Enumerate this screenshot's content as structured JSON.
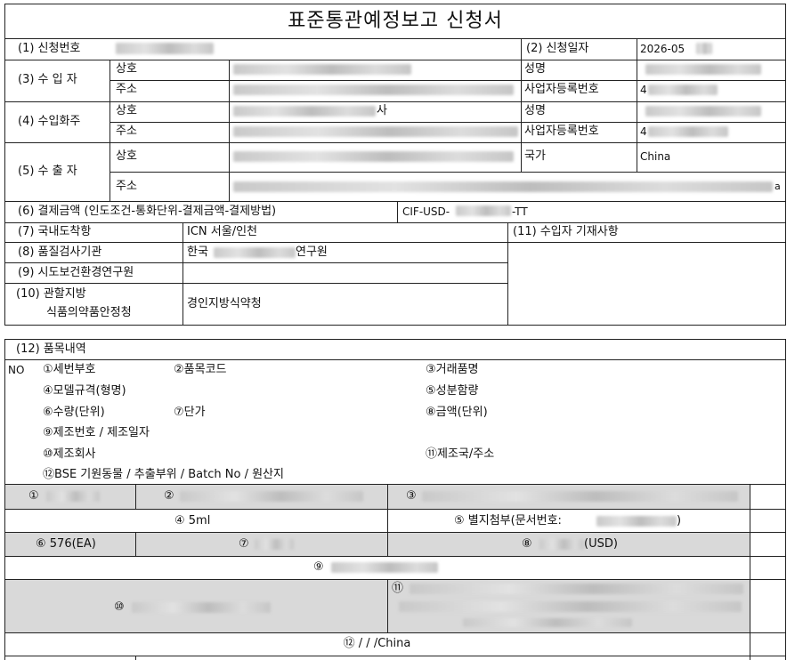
{
  "form": {
    "title": "표준통관예정보고 신청서",
    "row1": {
      "label": "(1) 신청번호",
      "date_label": "(2) 신청일자",
      "date_value": "2026-05"
    },
    "importer": {
      "label": "(3) 수 입 자",
      "trade_name": "상호",
      "address": "주소",
      "rep_name": "성명",
      "biz_reg_no": "사업자등록번호",
      "biz_reg_prefix": "4"
    },
    "owner": {
      "label": "(4) 수입화주",
      "trade_name": "상호",
      "address": "주소",
      "rep_name": "성명",
      "biz_reg_no": "사업자등록번호",
      "biz_reg_prefix": "4",
      "name_suffix": "사"
    },
    "exporter": {
      "label": "(5) 수 출 자",
      "trade_name": "상호",
      "address": "주소",
      "country_label": "국가",
      "country_value": "China",
      "addr_suffix": "a"
    },
    "payment": {
      "label": "(6) 결제금액 (인도조건-통화단위-결제금액-결제방법)",
      "value_prefix": "CIF-USD-",
      "value_suffix": "-TT"
    },
    "arrival_port": {
      "label": "(7) 국내도착항",
      "value": "ICN 서울/인천"
    },
    "importer_notes": {
      "label": "(11) 수입자 기재사항"
    },
    "inspection": {
      "label": "(8) 품질검사기관",
      "value_prefix": "한국",
      "value_suffix": "연구원"
    },
    "provincial": {
      "label": "(9) 시도보건환경연구원"
    },
    "jurisdiction": {
      "label_line1": "(10) 관할지방",
      "label_line2": "식품의약품안정청",
      "value": "경인지방식약청"
    }
  },
  "items": {
    "section_label": "(12) 품목내역",
    "no_label": "NO",
    "legend": {
      "c1": "①세번부호",
      "c2": "②품목코드",
      "c3": "③거래품명",
      "c4": "④모델규격(형명)",
      "c5": "⑤성분함량",
      "c6": "⑥수량(단위)",
      "c7": "⑦단가",
      "c8": "⑧금액(단위)",
      "c9": "⑨제조번호 / 제조일자",
      "c10": "⑩제조회사",
      "c11": "⑪제조국/주소",
      "c12": "⑫BSE 기원동물 / 추출부위 / Batch No / 원산지"
    },
    "row": {
      "n1": "①",
      "n2": "②",
      "n3": "③",
      "model": "④ 5ml",
      "attach_prefix": "⑤ 별지첨부(문서번호:",
      "attach_suffix": ")",
      "qty": "⑥ 576(EA)",
      "n7": "⑦",
      "amount_prefix": "⑧",
      "amount_suffix": "(USD)",
      "n9": "⑨",
      "n10": "⑩",
      "n11": "⑪",
      "bse": "⑫  / / /China"
    }
  }
}
